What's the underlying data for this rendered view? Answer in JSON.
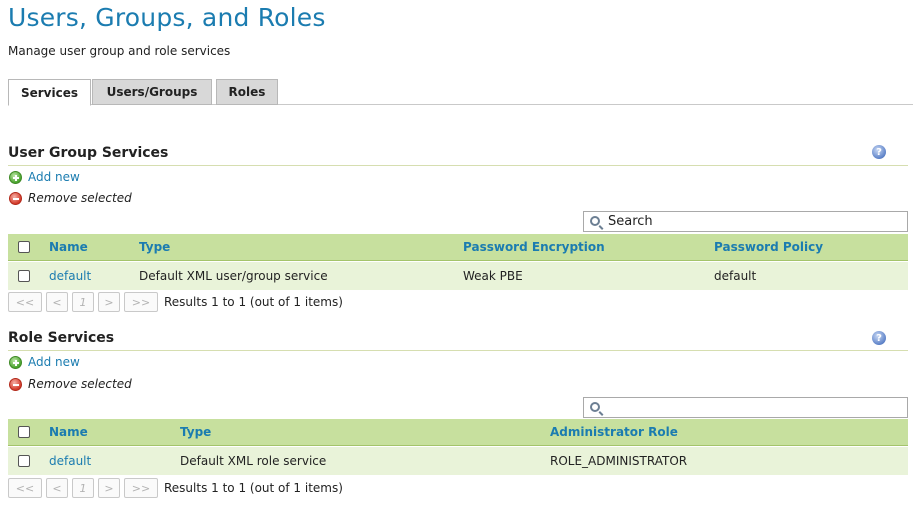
{
  "page": {
    "title": "Users, Groups, and Roles",
    "description": "Manage user group and role services"
  },
  "tabs": [
    {
      "label": "Services",
      "active": true
    },
    {
      "label": "Users/Groups",
      "active": false
    },
    {
      "label": "Roles",
      "active": false
    }
  ],
  "user_group_services": {
    "title": "User Group Services",
    "help_icon": "?",
    "add_label": "Add new",
    "remove_label": "Remove selected",
    "search_value": "Search",
    "columns": [
      "Name",
      "Type",
      "Password Encryption",
      "Password Policy"
    ],
    "rows": [
      {
        "name": "default",
        "type": "Default XML user/group service",
        "encryption": "Weak PBE",
        "policy": "default"
      }
    ],
    "pager": {
      "first": "<<",
      "prev": "<",
      "page": "1",
      "next": ">",
      "last": ">>",
      "info": "Results 1 to 1 (out of 1 items)"
    }
  },
  "role_services": {
    "title": "Role Services",
    "help_icon": "?",
    "add_label": "Add new",
    "remove_label": "Remove selected",
    "search_value": "",
    "columns": [
      "Name",
      "Type",
      "Administrator Role"
    ],
    "rows": [
      {
        "name": "default",
        "type": "Default XML role service",
        "admin_role": "ROLE_ADMINISTRATOR"
      }
    ],
    "pager": {
      "first": "<<",
      "prev": "<",
      "page": "1",
      "next": ">",
      "last": ">>",
      "info": "Results 1 to 1 (out of 1 items)"
    }
  },
  "colors": {
    "accent": "#1b7cb0",
    "grid_header": "#c7e09e",
    "grid_row": "#e9f3d9"
  }
}
